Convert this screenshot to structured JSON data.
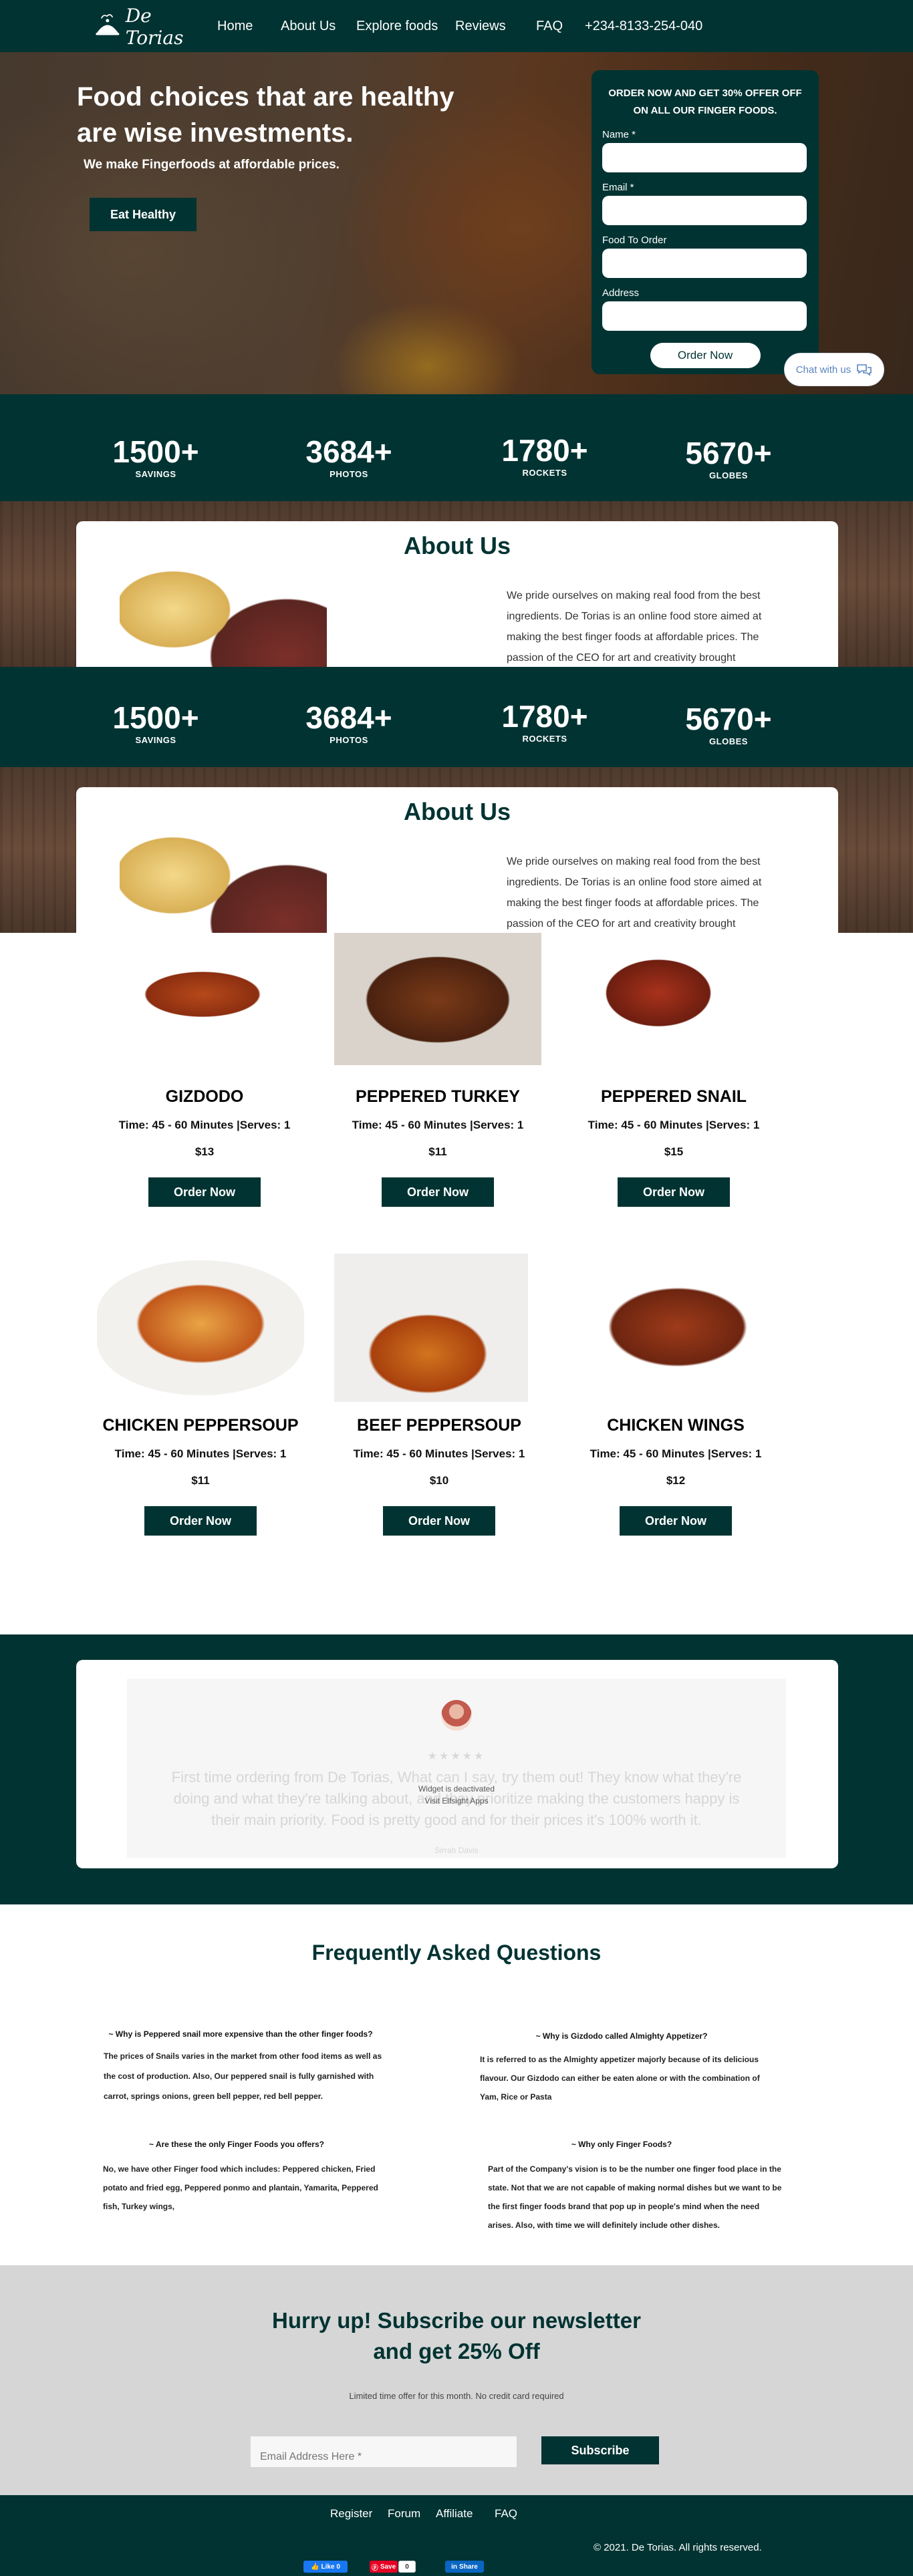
{
  "brand": {
    "name": "De Torias"
  },
  "nav": {
    "home": "Home",
    "about": "About Us",
    "explore": "Explore foods",
    "reviews": "Reviews",
    "faq": "FAQ",
    "phone": "+234-8133-254-040"
  },
  "hero": {
    "title": "Food choices that are healthy are wise investments.",
    "subtitle": "We make Fingerfoods at affordable prices.",
    "cta": "Eat Healthy"
  },
  "order_form": {
    "title": "ORDER NOW AND GET 30% OFFER OFF ON ALL OUR FINGER FOODS.",
    "name_label": "Name *",
    "email_label": "Email *",
    "food_label": "Food To Order",
    "address_label": "Address",
    "submit": "Order Now"
  },
  "chat": {
    "label": "Chat with us"
  },
  "stats": [
    {
      "number": "1500+",
      "label": "SAVINGS"
    },
    {
      "number": "3684+",
      "label": "PHOTOS"
    },
    {
      "number": "1780+",
      "label": "ROCKETS"
    },
    {
      "number": "5670+",
      "label": "GLOBES"
    }
  ],
  "about": {
    "title": "About Us",
    "text": "We pride ourselves on making real food from the best ingredients. De Torias is an online food store aimed at making the best finger foods at affordable prices. The passion of the CEO for art and creativity brought"
  },
  "products": [
    {
      "name": "GIZDODO",
      "meta": "Time: 45 - 60 Minutes |Serves: 1",
      "price": "$13",
      "button": "Order Now"
    },
    {
      "name": "PEPPERED TURKEY",
      "meta": "Time: 45 - 60 Minutes |Serves: 1",
      "price": "$11",
      "button": "Order Now"
    },
    {
      "name": "PEPPERED SNAIL",
      "meta": "Time: 45 - 60 Minutes |Serves: 1",
      "price": "$15",
      "button": "Order Now"
    },
    {
      "name": "CHICKEN PEPPERSOUP",
      "meta": "Time: 45 - 60 Minutes |Serves: 1",
      "price": "$11",
      "button": "Order Now"
    },
    {
      "name": "BEEF PEPPERSOUP",
      "meta": "Time: 45 - 60 Minutes |Serves: 1",
      "price": "$10",
      "button": "Order Now"
    },
    {
      "name": "CHICKEN WINGS",
      "meta": "Time: 45 - 60 Minutes |Serves: 1",
      "price": "$12",
      "button": "Order Now"
    }
  ],
  "testimonial": {
    "stars": "★★★★★",
    "quote": "First time ordering from De Torias, What can I say, try them out! They know what they're doing and what they're talking about, and they prioritize making the customers happy is their main priority. Food is pretty good and for their prices it's 100% worth it.",
    "author": "Sirrah Davis",
    "widget_line1": "Widget is deactivated",
    "widget_line2": "Visit Elfsight Apps"
  },
  "faq": {
    "title": "Frequently Asked Questions",
    "items": [
      {
        "q": "~ Why is Peppered snail more expensive than the other finger foods?",
        "a": "The prices of Snails varies in the market from other food items as well as the cost of production. Also, Our peppered snail is fully garnished with carrot, springs onions, green bell pepper, red bell pepper."
      },
      {
        "q": "~ Why is Gizdodo called Almighty Appetizer?",
        "a": "It is referred to as the Almighty appetizer majorly because of its delicious flavour. Our Gizdodo can either be eaten alone or with the combination of Yam, Rice or Pasta"
      },
      {
        "q": "~ Are these the only Finger Foods you offers?",
        "a": "No, we have other Finger food which includes: Peppered chicken, Fried potato and fried egg, Peppered ponmo and plantain, Yamarita, Peppered fish, Turkey wings,"
      },
      {
        "q": "~ Why only Finger Foods?",
        "a": "Part of the Company's vision is to be the number one finger food place in the state. Not that we are not capable of making normal dishes but we want to be the first finger foods brand that pop up in people's mind when the need arises. Also, with time we will definitely include other dishes."
      }
    ]
  },
  "newsletter": {
    "title_line1": "Hurry up! Subscribe our newsletter",
    "title_line2": "and get 25% Off",
    "note": "Limited time offer for this month. No credit card required",
    "placeholder": "Email Address Here *",
    "button": "Subscribe"
  },
  "footer": {
    "links": [
      "Register",
      "Forum",
      "Affiliate",
      "FAQ"
    ],
    "copyright": "© 2021. De Torias. All rights reserved.",
    "share": {
      "like": "Like 0",
      "save": "Save",
      "save_count": "0",
      "share": "Share"
    }
  },
  "colors": {
    "brand": "#003332",
    "newsletter_bg": "#d6d6d6",
    "pinterest": "#e60023",
    "facebook": "#1877f2",
    "linkedin": "#0a66c2"
  },
  "icons": {
    "logo": "chef-cloche-icon",
    "chat": "chat-bubbles-icon"
  }
}
